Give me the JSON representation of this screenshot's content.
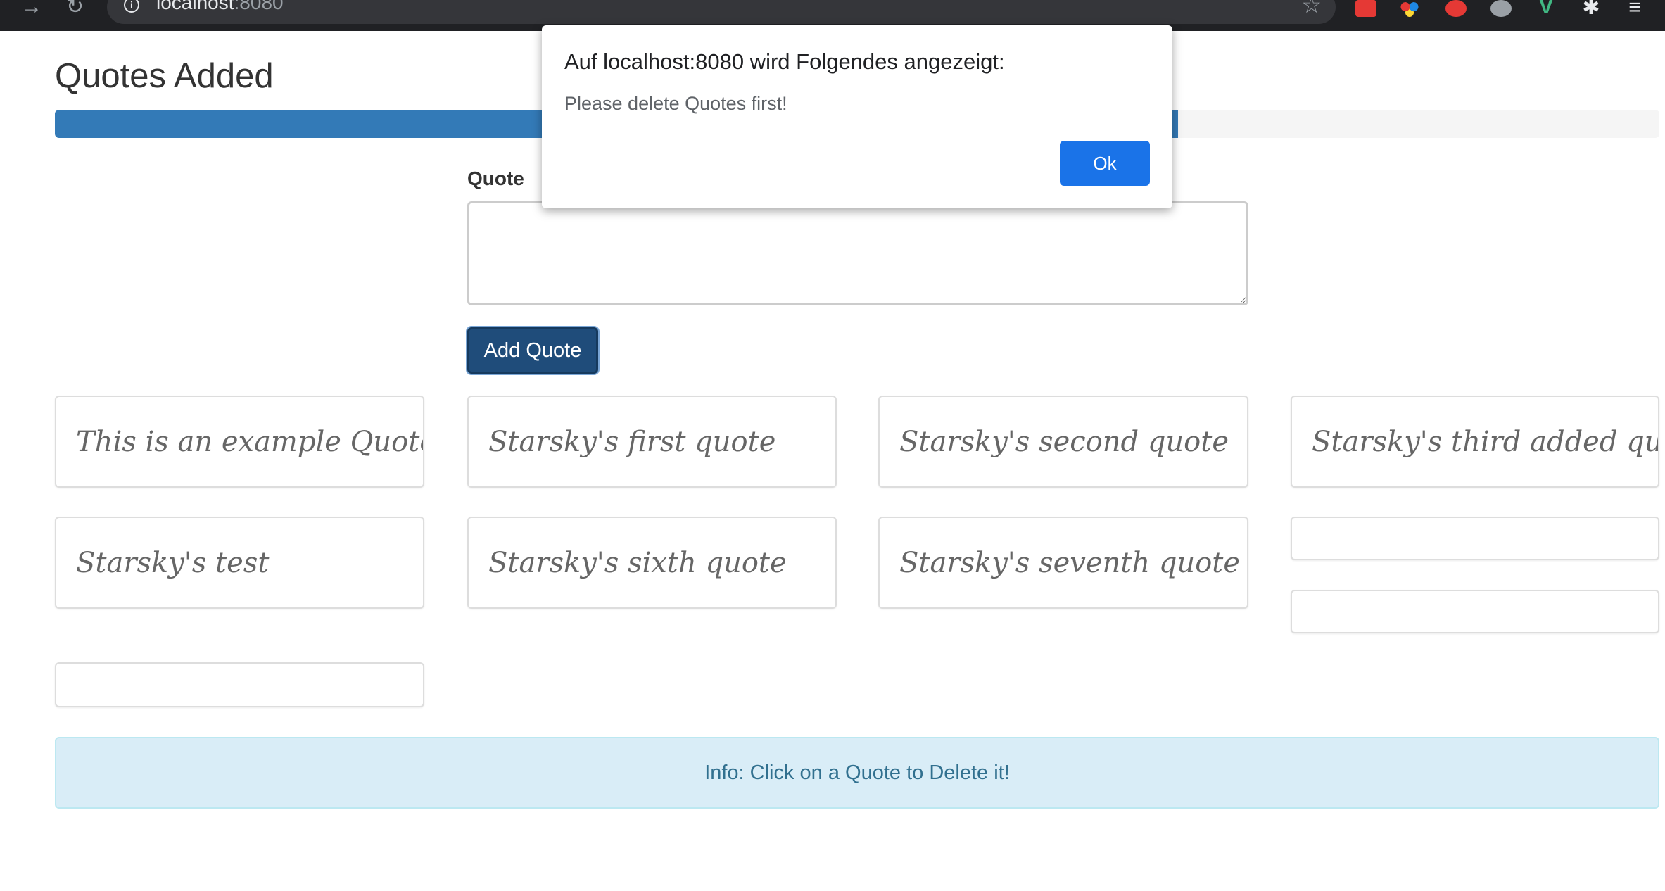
{
  "browser": {
    "url_host": "localhost",
    "url_port": ":8080",
    "back_icon": "arrow-right-icon",
    "reload_icon": "reload-icon",
    "star_icon": "star-icon"
  },
  "page": {
    "title": "Quotes Added",
    "progress_fraction": 0.7,
    "progress_color": "#337ab7",
    "quote_label": "Quote",
    "textarea_value": "",
    "add_button": "Add Quote",
    "quotes": [
      "This is an example Quote.",
      "Starsky's first quote",
      "Starsky's second quote",
      "Starsky's third added quote",
      "Starsky's test",
      "Starsky's sixth quote",
      "Starsky's seventh quote",
      "",
      "",
      ""
    ],
    "info": "Info: Click on a Quote to Delete it!"
  },
  "dialog": {
    "title": "Auf localhost:8080 wird Folgendes angezeigt:",
    "message": "Please delete Quotes first!",
    "ok_label": "Ok",
    "ok_color": "#1a73e8"
  }
}
